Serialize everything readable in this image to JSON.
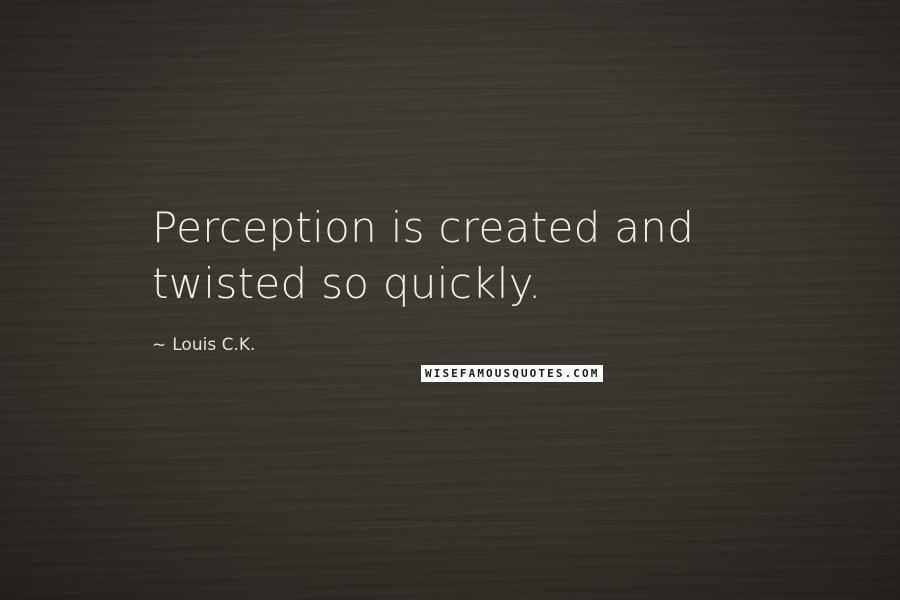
{
  "quote": {
    "text": "Perception is created and twisted so quickly.",
    "author_prefix": "~",
    "author": "Louis C.K."
  },
  "logo": {
    "wise": "WISEFAMOUSQUOTES",
    "dot": ".",
    "com": "COM"
  },
  "colors": {
    "background": "#3a342e",
    "quote_text": "#f1efe9",
    "logo_bg": "#ffffff",
    "logo_fg": "#1a1a1a"
  }
}
